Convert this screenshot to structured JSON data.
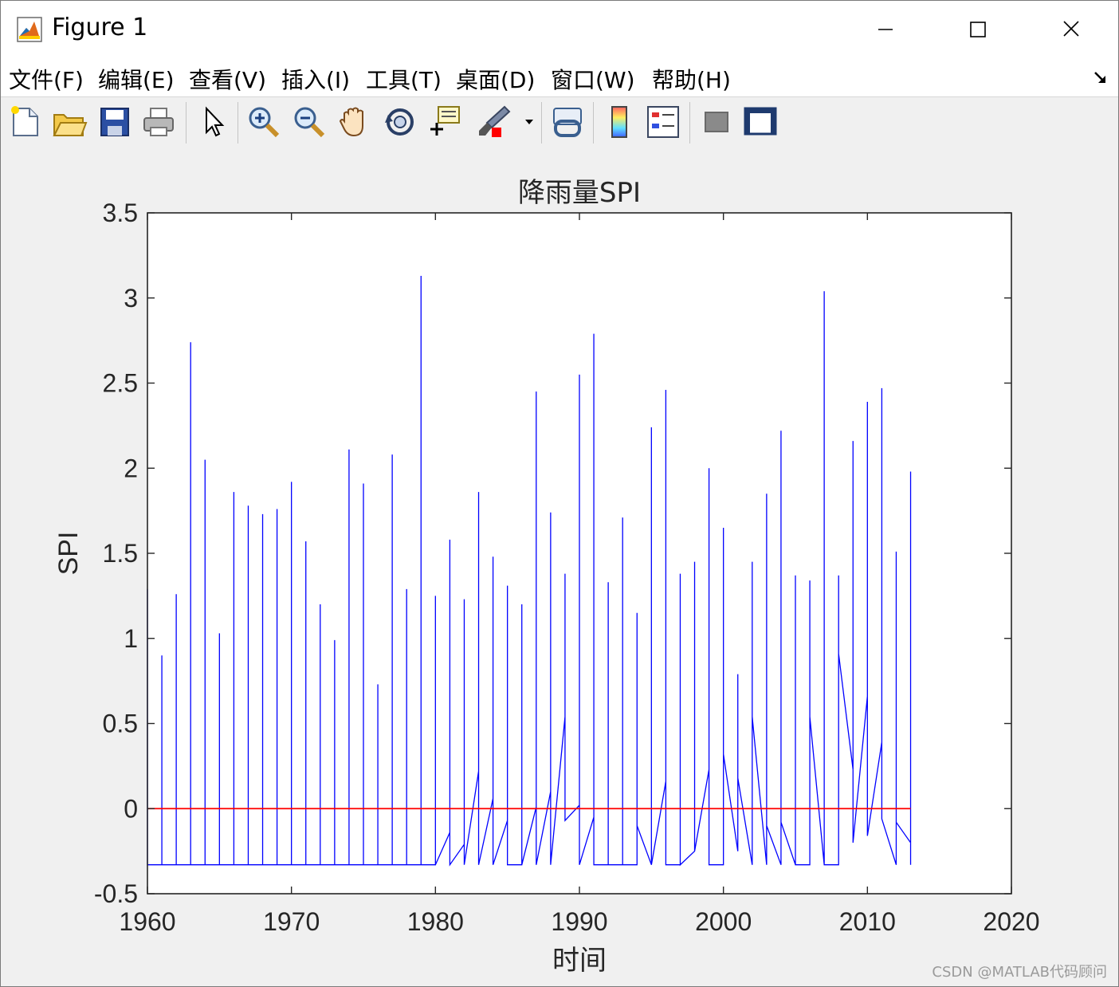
{
  "window": {
    "title": "Figure 1",
    "controls": {
      "minimize": "minimize",
      "maximize": "maximize",
      "close": "close"
    }
  },
  "menubar": {
    "items": [
      "文件(F)",
      "编辑(E)",
      "查看(V)",
      "插入(I)",
      "工具(T)",
      "桌面(D)",
      "窗口(W)",
      "帮助(H)"
    ]
  },
  "toolbar": {
    "buttons": [
      {
        "icon": "new-figure-icon"
      },
      {
        "icon": "open-file-icon"
      },
      {
        "icon": "save-icon"
      },
      {
        "icon": "print-icon"
      },
      {
        "icon": "edit-plot-cursor-icon"
      },
      {
        "icon": "zoom-in-icon"
      },
      {
        "icon": "zoom-out-icon"
      },
      {
        "icon": "pan-hand-icon"
      },
      {
        "icon": "rotate-3d-icon"
      },
      {
        "icon": "data-cursor-icon"
      },
      {
        "icon": "brush-icon"
      },
      {
        "icon": "link-plot-icon"
      },
      {
        "icon": "colorbar-icon"
      },
      {
        "icon": "legend-icon"
      },
      {
        "icon": "hide-plot-tools-icon"
      },
      {
        "icon": "show-plot-tools-icon"
      }
    ]
  },
  "chart_data": {
    "type": "line",
    "title": "降雨量SPI",
    "xlabel": "时间",
    "ylabel": "SPI",
    "xlim": [
      1960,
      2020
    ],
    "ylim": [
      -0.5,
      3.5
    ],
    "xticks": [
      1960,
      1970,
      1980,
      1990,
      2000,
      2010,
      2020
    ],
    "xtick_labels": [
      "1960",
      "1970",
      "1980",
      "1990",
      "2000",
      "2010",
      "2020"
    ],
    "yticks": [
      -0.5,
      0,
      0.5,
      1,
      1.5,
      2,
      2.5,
      3,
      3.5
    ],
    "ytick_labels": [
      "-0.5",
      "0",
      "0.5",
      "1",
      "1.5",
      "2",
      "2.5",
      "3",
      "3.5"
    ],
    "grid": false,
    "series": [
      {
        "color": "#0000ff",
        "x": [
          1960,
          1960,
          1961,
          1961,
          1961,
          1962,
          1962,
          1962,
          1963,
          1963,
          1963,
          1964,
          1964,
          1964,
          1965,
          1965,
          1965,
          1966,
          1966,
          1966,
          1967,
          1967,
          1967,
          1968,
          1968,
          1968,
          1969,
          1969,
          1969,
          1970,
          1970,
          1970,
          1971,
          1971,
          1971,
          1972,
          1972,
          1972,
          1973,
          1973,
          1973,
          1974,
          1974,
          1974,
          1975,
          1975,
          1975,
          1976,
          1976,
          1976,
          1977,
          1977,
          1977,
          1978,
          1978,
          1978,
          1979,
          1979,
          1979,
          1980,
          1980,
          1980,
          1981,
          1981,
          1981,
          1982,
          1982,
          1982,
          1983,
          1983,
          1983,
          1984,
          1984,
          1984,
          1985,
          1985,
          1985,
          1986,
          1986,
          1986,
          1987,
          1987,
          1987,
          1988,
          1988,
          1988,
          1989,
          1989,
          1989,
          1990,
          1990,
          1990,
          1991,
          1991,
          1991,
          1992,
          1992,
          1992,
          1993,
          1993,
          1993,
          1994,
          1994,
          1994,
          1995,
          1995,
          1995,
          1996,
          1996,
          1996,
          1997,
          1997,
          1997,
          1998,
          1998,
          1998,
          1999,
          1999,
          1999,
          2000,
          2000,
          2000,
          2001,
          2001,
          2001,
          2002,
          2002,
          2002,
          2003,
          2003,
          2003,
          2004,
          2004,
          2004,
          2005,
          2005,
          2005,
          2006,
          2006,
          2006,
          2007,
          2007,
          2007,
          2008,
          2008,
          2008,
          2009,
          2009,
          2009,
          2010,
          2010,
          2010,
          2011,
          2011,
          2011,
          2012,
          2012,
          2012,
          2013,
          2013,
          2013
        ],
        "y": [
          1.29,
          -0.33,
          -0.33,
          0.9,
          -0.33,
          -0.33,
          1.26,
          -0.33,
          -0.33,
          2.74,
          -0.33,
          -0.33,
          2.05,
          -0.33,
          -0.33,
          1.03,
          -0.33,
          -0.33,
          1.86,
          -0.33,
          -0.33,
          1.78,
          -0.33,
          -0.33,
          1.73,
          -0.33,
          -0.33,
          1.76,
          -0.33,
          -0.33,
          1.92,
          -0.33,
          -0.33,
          1.57,
          -0.33,
          -0.33,
          1.2,
          -0.33,
          -0.33,
          0.99,
          -0.33,
          -0.33,
          2.11,
          -0.33,
          -0.33,
          1.91,
          -0.33,
          -0.33,
          0.73,
          -0.33,
          -0.33,
          2.08,
          -0.33,
          -0.33,
          1.29,
          -0.33,
          -0.33,
          3.13,
          -0.33,
          -0.33,
          1.25,
          -0.33,
          -0.14,
          1.58,
          -0.33,
          -0.21,
          1.23,
          -0.33,
          0.22,
          1.86,
          -0.33,
          0.06,
          1.48,
          -0.33,
          -0.07,
          1.31,
          -0.33,
          -0.33,
          1.2,
          -0.33,
          0.01,
          2.45,
          -0.33,
          0.1,
          1.74,
          -0.33,
          0.54,
          1.38,
          -0.07,
          0.02,
          2.55,
          -0.33,
          -0.05,
          2.79,
          -0.33,
          -0.33,
          1.33,
          -0.33,
          -0.33,
          1.71,
          -0.33,
          -0.33,
          1.15,
          -0.1,
          -0.33,
          2.24,
          -0.33,
          0.16,
          2.46,
          -0.33,
          -0.33,
          1.38,
          -0.33,
          -0.25,
          1.45,
          -0.25,
          0.23,
          2.0,
          -0.33,
          -0.33,
          1.65,
          0.32,
          -0.25,
          0.79,
          0.18,
          -0.33,
          1.45,
          0.54,
          -0.33,
          1.85,
          -0.1,
          -0.33,
          2.22,
          -0.08,
          -0.33,
          1.37,
          -0.33,
          -0.33,
          1.34,
          0.54,
          -0.33,
          3.04,
          -0.33,
          -0.33,
          1.37,
          0.91,
          0.23,
          2.16,
          -0.2,
          0.66,
          2.39,
          -0.16,
          0.39,
          2.47,
          -0.06,
          -0.33,
          1.51,
          -0.08,
          -0.2,
          1.98,
          -0.33
        ]
      },
      {
        "color": "#ff0000",
        "x": [
          1960,
          2013
        ],
        "y": [
          0,
          0
        ]
      }
    ],
    "watermark": "CSDN @MATLAB代码顾问"
  }
}
